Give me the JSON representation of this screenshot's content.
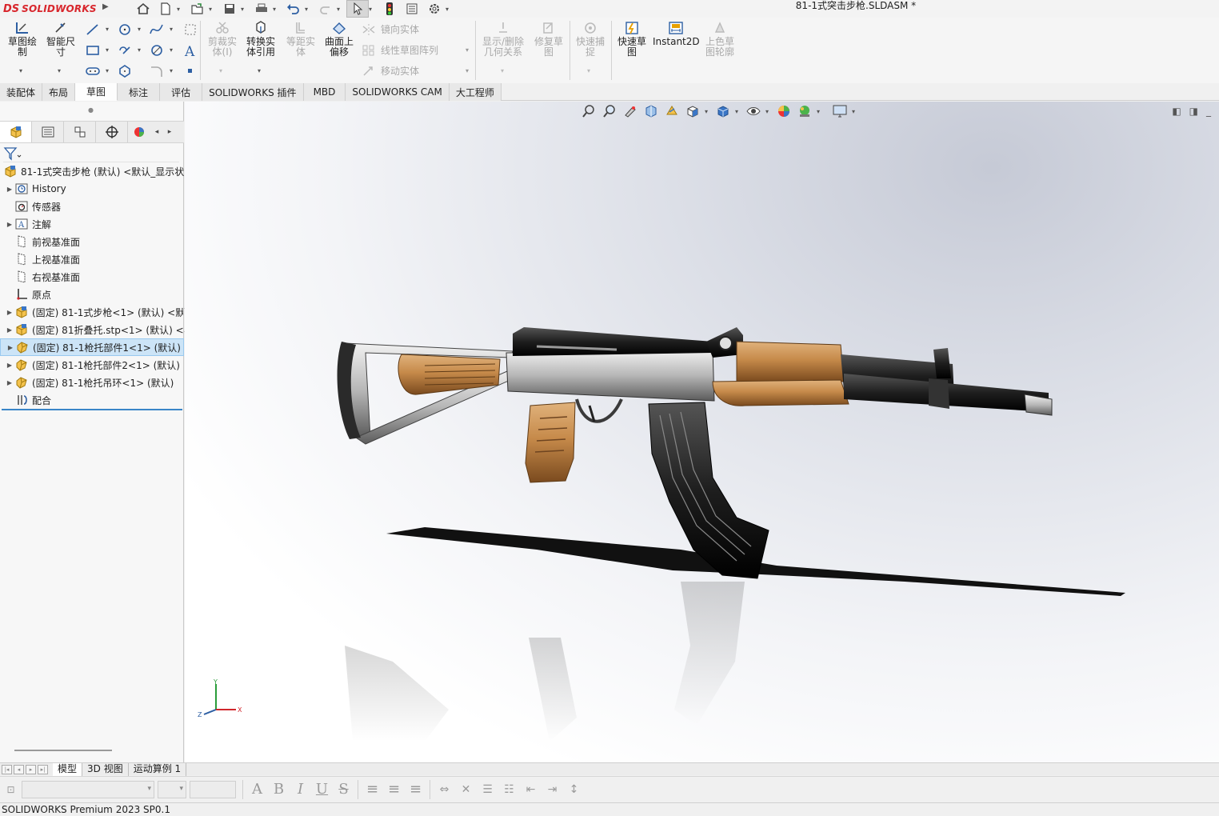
{
  "app": {
    "logo_ds": "DS",
    "logo_name": "SOLIDWORKS",
    "document_title": "81-1式突击步枪.SLDASM *",
    "status_text": "SOLIDWORKS Premium 2023 SP0.1",
    "brand_color": "#d8262c",
    "selection_color": "#cce4f7"
  },
  "ribbon": {
    "sketch": "草图绘\n制",
    "smart_dimension": "智能尺\n寸",
    "trim_entities": "剪裁实\n体(I)",
    "convert_entities": "转换实\n体引用",
    "offset_entities": "等距实\n体",
    "offset_on_surface": "曲面上\n偏移",
    "mirror_entities": "镜向实体",
    "linear_pattern": "线性草图阵列",
    "move_entities": "移动实体",
    "display_delete_relations": "显示/删除\n几何关系",
    "repair_sketch": "修复草\n图",
    "quick_snaps": "快速捕\n捉",
    "rapid_sketch": "快速草\n图",
    "instant2d": "Instant2D",
    "shaded_sketch_contours": "上色草\n图轮廓"
  },
  "tabs": [
    {
      "label": "装配体",
      "active": false
    },
    {
      "label": "布局",
      "active": false
    },
    {
      "label": "草图",
      "active": true
    },
    {
      "label": "标注",
      "active": false
    },
    {
      "label": "评估",
      "active": false
    },
    {
      "label": "SOLIDWORKS 插件",
      "active": false
    },
    {
      "label": "MBD",
      "active": false
    },
    {
      "label": "SOLIDWORKS CAM",
      "active": false
    },
    {
      "label": "大工程师",
      "active": false
    }
  ],
  "tree": {
    "root": "81-1式突击步枪 (默认) <默认_显示状",
    "items": [
      {
        "label": "History",
        "expand": true,
        "icon": "history-icon"
      },
      {
        "label": "传感器",
        "expand": false,
        "icon": "sensor-icon"
      },
      {
        "label": "注解",
        "expand": true,
        "icon": "annotation-icon"
      },
      {
        "label": "前视基准面",
        "expand": false,
        "icon": "plane-icon"
      },
      {
        "label": "上视基准面",
        "expand": false,
        "icon": "plane-icon"
      },
      {
        "label": "右视基准面",
        "expand": false,
        "icon": "plane-icon"
      },
      {
        "label": "原点",
        "expand": false,
        "icon": "origin-icon"
      },
      {
        "label": "(固定) 81-1式步枪<1> (默认) <默",
        "expand": true,
        "icon": "subassembly-icon"
      },
      {
        "label": "(固定) 81折叠托.stp<1> (默认) <",
        "expand": true,
        "icon": "subassembly-icon"
      },
      {
        "label": "(固定) 81-1枪托部件1<1> (默认)",
        "expand": true,
        "icon": "part-icon",
        "selected": true
      },
      {
        "label": "(固定) 81-1枪托部件2<1> (默认)",
        "expand": true,
        "icon": "part-icon"
      },
      {
        "label": "(固定) 81-1枪托吊环<1> (默认)",
        "expand": true,
        "icon": "part-icon"
      },
      {
        "label": "配合",
        "expand": false,
        "icon": "mates-icon"
      }
    ]
  },
  "model_tabs": [
    {
      "label": "模型",
      "active": true
    },
    {
      "label": "3D 视图",
      "active": false
    },
    {
      "label": "运动算例 1",
      "active": false
    }
  ],
  "triad": {
    "x": "X",
    "y": "Y",
    "z": "Z"
  }
}
